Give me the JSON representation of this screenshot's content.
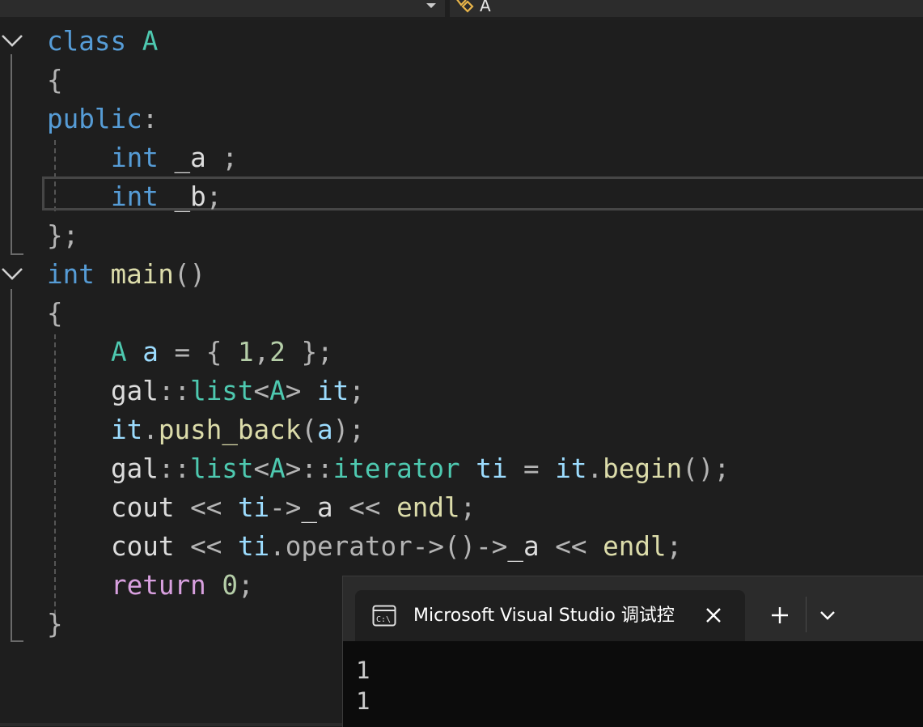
{
  "navbar": {
    "symbol_label": "A"
  },
  "code": {
    "line1": {
      "kw": "class",
      "name": "A"
    },
    "line2": {
      "brace": "{"
    },
    "line3": {
      "kw": "public",
      "colon": ":"
    },
    "line4": {
      "type": "int",
      "var": "_a",
      "semi": " ;"
    },
    "line5": {
      "type": "int",
      "var": "_b",
      "semi": ";"
    },
    "line6": {
      "close": "};"
    },
    "line7": {
      "type": "int",
      "fn": "main",
      "parens": "()"
    },
    "line8": {
      "brace": "{"
    },
    "line9": {
      "cls": "A",
      "var": "a",
      "eq": " = { ",
      "n1": "1",
      "comma": ",",
      "n2": "2",
      "end": " };"
    },
    "line10": {
      "ns": "gal",
      "sep": "::",
      "tmpl": "list",
      "lt": "<",
      "arg": "A",
      "gt": ">",
      "var": "it",
      "semi": ";"
    },
    "line11": {
      "obj": "it",
      "dot": ".",
      "fn": "push_back",
      "lp": "(",
      "arg": "a",
      "rp": ")",
      "semi": ";"
    },
    "line12": {
      "ns": "gal",
      "sep": "::",
      "tmpl": "list",
      "lt": "<",
      "arg": "A",
      "gt": ">",
      "sep2": "::",
      "nested": "iterator",
      "var": "ti",
      "eq": " = ",
      "obj": "it",
      "dot": ".",
      "fn": "begin",
      "tail": "();"
    },
    "line13": {
      "cout": "cout",
      "op1": " << ",
      "ti": "ti",
      "arrow": "->",
      "mem": "_a",
      "op2": " << ",
      "endl": "endl",
      "semi": ";"
    },
    "line14": {
      "cout": "cout",
      "op1": " << ",
      "ti": "ti",
      "dot": ".",
      "oper": "operator->",
      "call": "()->",
      "mem": "_a",
      "op2": " << ",
      "endl": "endl",
      "semi": ";"
    },
    "line15": {
      "kw": "return",
      "num": "0",
      "semi": ";"
    },
    "line16": {
      "brace": "}"
    }
  },
  "terminal": {
    "tab_title": "Microsoft Visual Studio 调试控",
    "output": [
      "1",
      "1"
    ]
  },
  "colors": {
    "keyword": "#569cd6",
    "type": "#4ec9b0",
    "function": "#dcdcaa",
    "variable": "#9cdcfe",
    "number": "#b5cea8",
    "control": "#d8a0df",
    "background": "#1e1e1e"
  },
  "icons": [
    "chevron-down-icon",
    "symbol-class-icon",
    "fold-chevron-icon",
    "console-icon",
    "close-icon",
    "plus-icon"
  ]
}
